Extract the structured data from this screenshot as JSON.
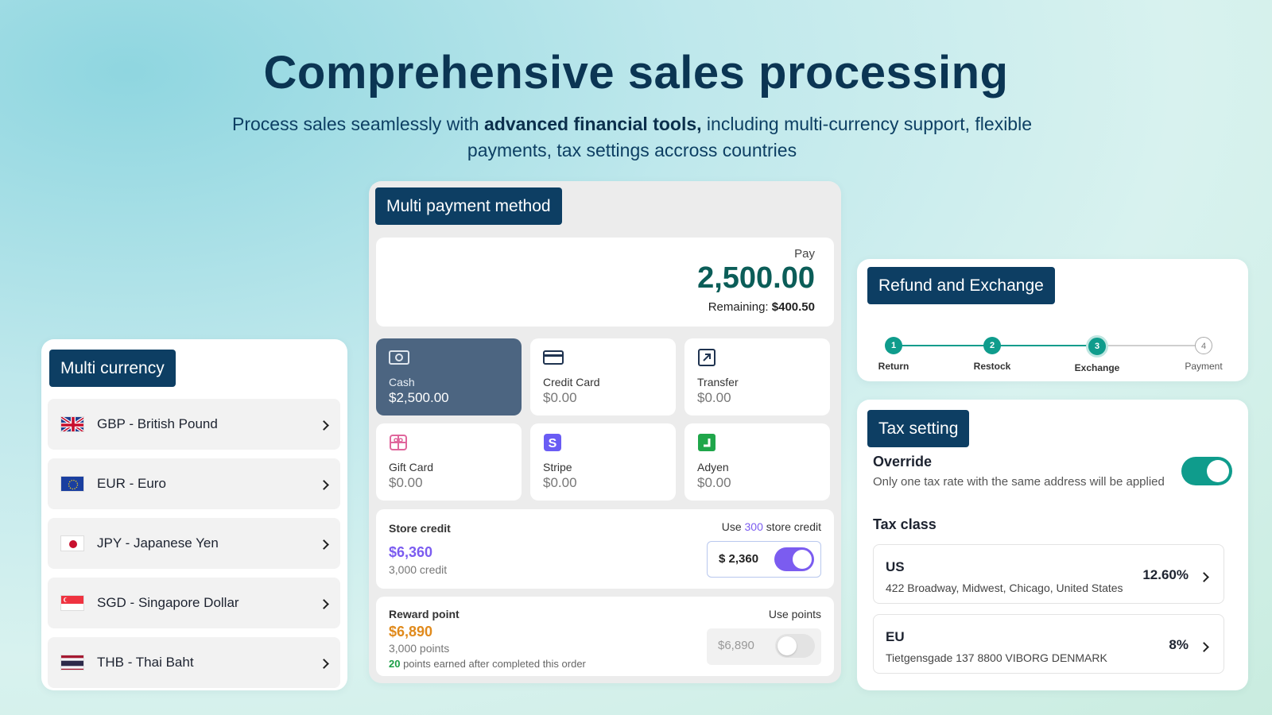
{
  "hero": {
    "title": "Comprehensive sales processing",
    "sub_pre": "Process sales seamlessly with ",
    "sub_bold": "advanced financial tools,",
    "sub_post": " including multi-currency support, flexible payments, tax settings accross countries"
  },
  "currency": {
    "tag": "Multi currency",
    "items": [
      {
        "label": "GBP - British Pound",
        "flag": "uk-flag-icon"
      },
      {
        "label": "EUR - Euro",
        "flag": "eu-flag-icon"
      },
      {
        "label": "JPY - Japanese Yen",
        "flag": "japan-flag-icon"
      },
      {
        "label": "SGD - Singapore Dollar",
        "flag": "singapore-flag-icon"
      },
      {
        "label": "THB - Thai Baht",
        "flag": "thailand-flag-icon"
      }
    ]
  },
  "payment": {
    "tag": "Multi payment method",
    "pay_label": "Pay",
    "pay_amount": "2,500.00",
    "remaining_label": "Remaining:",
    "remaining_value": "$400.50",
    "methods": [
      {
        "label": "Cash",
        "value": "$2,500.00",
        "icon": "cash-icon"
      },
      {
        "label": "Credit Card",
        "value": "$0.00",
        "icon": "credit-card-icon"
      },
      {
        "label": "Transfer",
        "value": "$0.00",
        "icon": "transfer-icon"
      },
      {
        "label": "Gift Card",
        "value": "$0.00",
        "icon": "gift-card-icon"
      },
      {
        "label": "Stripe",
        "value": "$0.00",
        "icon": "stripe-icon"
      },
      {
        "label": "Adyen",
        "value": "$0.00",
        "icon": "adyen-icon"
      }
    ],
    "store_credit": {
      "title": "Store credit",
      "amount": "$6,360",
      "sub": "3,000 credit",
      "use_pre": "Use ",
      "use_num": "300",
      "use_post": " store credit",
      "input_value": "$ 2,360",
      "toggle_on": true
    },
    "reward": {
      "title": "Reward point",
      "amount": "$6,890",
      "sub": "3,000 points",
      "earn_num": "20",
      "earn_text": " points earned after completed this order",
      "use_label": "Use points",
      "input_value": "$6,890",
      "toggle_on": false
    }
  },
  "refund": {
    "tag": "Refund and Exchange",
    "steps": [
      {
        "num": "1",
        "label": "Return"
      },
      {
        "num": "2",
        "label": "Restock"
      },
      {
        "num": "3",
        "label": "Exchange"
      },
      {
        "num": "4",
        "label": "Payment"
      }
    ]
  },
  "tax": {
    "tag": "Tax setting",
    "override_title": "Override",
    "override_desc": "Only one tax rate with the same address will be applied",
    "override_on": true,
    "class_title": "Tax class",
    "classes": [
      {
        "code": "US",
        "address": "422 Broadway, Midwest, Chicago, United States",
        "rate": "12.60%"
      },
      {
        "code": "EU",
        "address": "Tietgensgade 137 8800 VIBORG DENMARK",
        "rate": "8%"
      }
    ]
  },
  "colors": {
    "navy": "#0d3e63",
    "teal": "#0f9c8c",
    "purple": "#7b5cf0",
    "orange": "#e08a1c",
    "green": "#1a9e46"
  }
}
